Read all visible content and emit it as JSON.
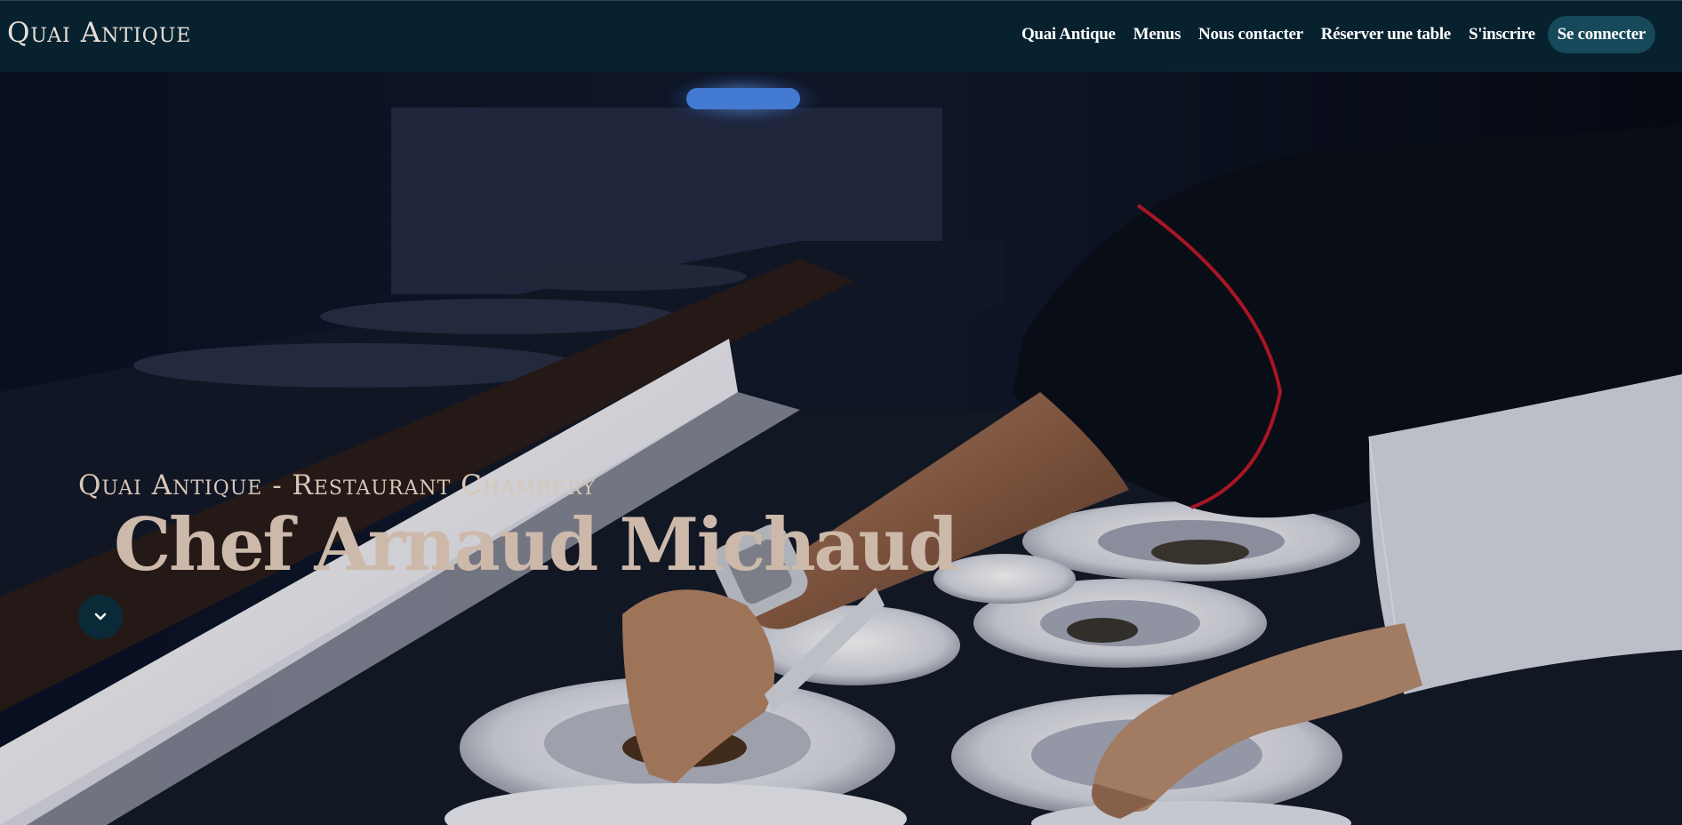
{
  "nav": {
    "brand": "Quai Antique",
    "links": [
      {
        "label": "Quai Antique"
      },
      {
        "label": "Menus"
      },
      {
        "label": "Nous contacter"
      },
      {
        "label": "Réserver une table"
      },
      {
        "label": "S'inscrire"
      }
    ],
    "cta_label": "Se connecter"
  },
  "hero": {
    "subtitle": "Quai Antique - Restaurant Chambery",
    "title": "Chef Arnaud Michaud",
    "scroll_icon": "chevron-down-icon"
  },
  "colors": {
    "navbar_bg": "#07212f",
    "cta_bg": "#16495a",
    "title_color": "#cdb9aa",
    "scroll_button_bg": "#0b2a38"
  }
}
